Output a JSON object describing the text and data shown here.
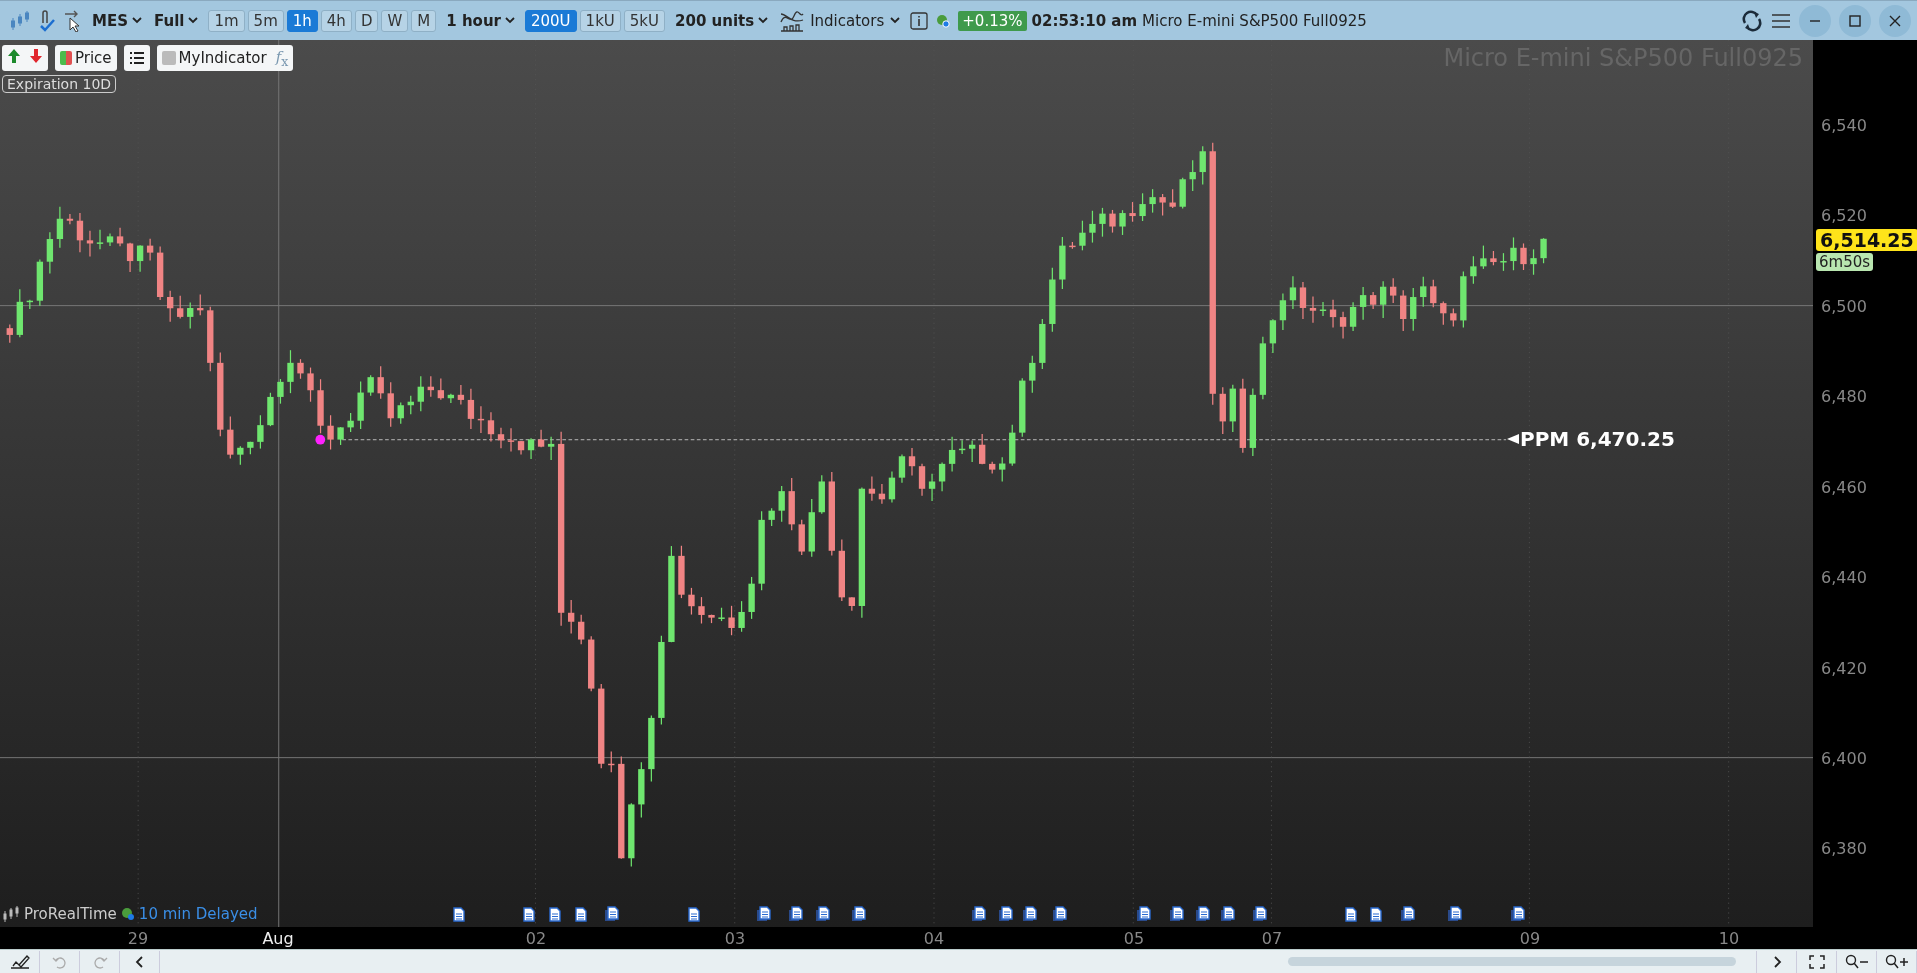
{
  "toolbar": {
    "symbol": "MES",
    "mode": "Full",
    "timeframes": [
      {
        "label": "1m",
        "selected": false
      },
      {
        "label": "5m",
        "selected": false
      },
      {
        "label": "1h",
        "selected": true
      },
      {
        "label": "4h",
        "selected": false
      },
      {
        "label": "D",
        "selected": false
      },
      {
        "label": "W",
        "selected": false
      },
      {
        "label": "M",
        "selected": false
      }
    ],
    "period": "1 hour",
    "unit_buttons": [
      {
        "label": "200U",
        "selected": true
      },
      {
        "label": "1kU",
        "selected": false
      },
      {
        "label": "5kU",
        "selected": false
      }
    ],
    "units": "200 units",
    "indicators": "Indicators",
    "change": "+0.13%",
    "time": "02:53:10 am",
    "instrument": "Micro E-mini S&P500 Full0925"
  },
  "chart": {
    "legend": {
      "price": "Price",
      "indicator": "MyIndicator",
      "formula": "*f*$_{x}$"
    },
    "expiration": "Expiration 10D",
    "watermark": "Micro E-mini S&P500 Full0925",
    "ppm_label": "PPM 6,470.25"
  },
  "price_axis": {
    "labels": [
      "6,540",
      "6,520",
      "6,500",
      "6,480",
      "6,460",
      "6,440",
      "6,420",
      "6,400",
      "6,380"
    ],
    "current_price": "6,514.25",
    "timer": "6m50s"
  },
  "time_axis": [
    {
      "label": "29",
      "kind": "day"
    },
    {
      "label": "Aug",
      "kind": "month"
    },
    {
      "label": "02",
      "kind": "day"
    },
    {
      "label": "03",
      "kind": "day"
    },
    {
      "label": "04",
      "kind": "day"
    },
    {
      "label": "05",
      "kind": "day"
    },
    {
      "label": "07",
      "kind": "day"
    },
    {
      "label": "09",
      "kind": "day"
    },
    {
      "label": "10",
      "kind": "day"
    }
  ],
  "footer": {
    "brand": "ProRealTime",
    "feed": "10 min Delayed"
  }
}
